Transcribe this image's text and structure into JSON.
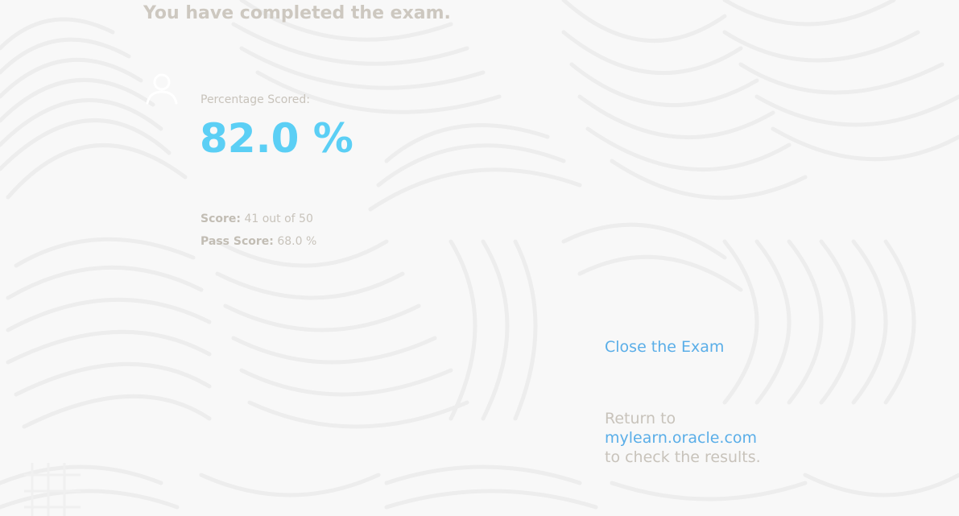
{
  "heading": "You have completed the exam.",
  "result": {
    "percentage_label": "Percentage Scored:",
    "percentage_value": "82.0 %",
    "score_label": "Score:",
    "score_value": "41 out of 50",
    "pass_label": "Pass Score:",
    "pass_value": "68.0 %"
  },
  "actions": {
    "close_label": "Close the Exam",
    "return_prefix": "Return to",
    "return_link": "mylearn.oracle.com",
    "return_suffix": "to check the results."
  },
  "icons": {
    "user": "user-icon"
  },
  "colors": {
    "accent": "#5bcff5",
    "link": "#5aaee8",
    "muted_text": "#c8c3bb"
  }
}
